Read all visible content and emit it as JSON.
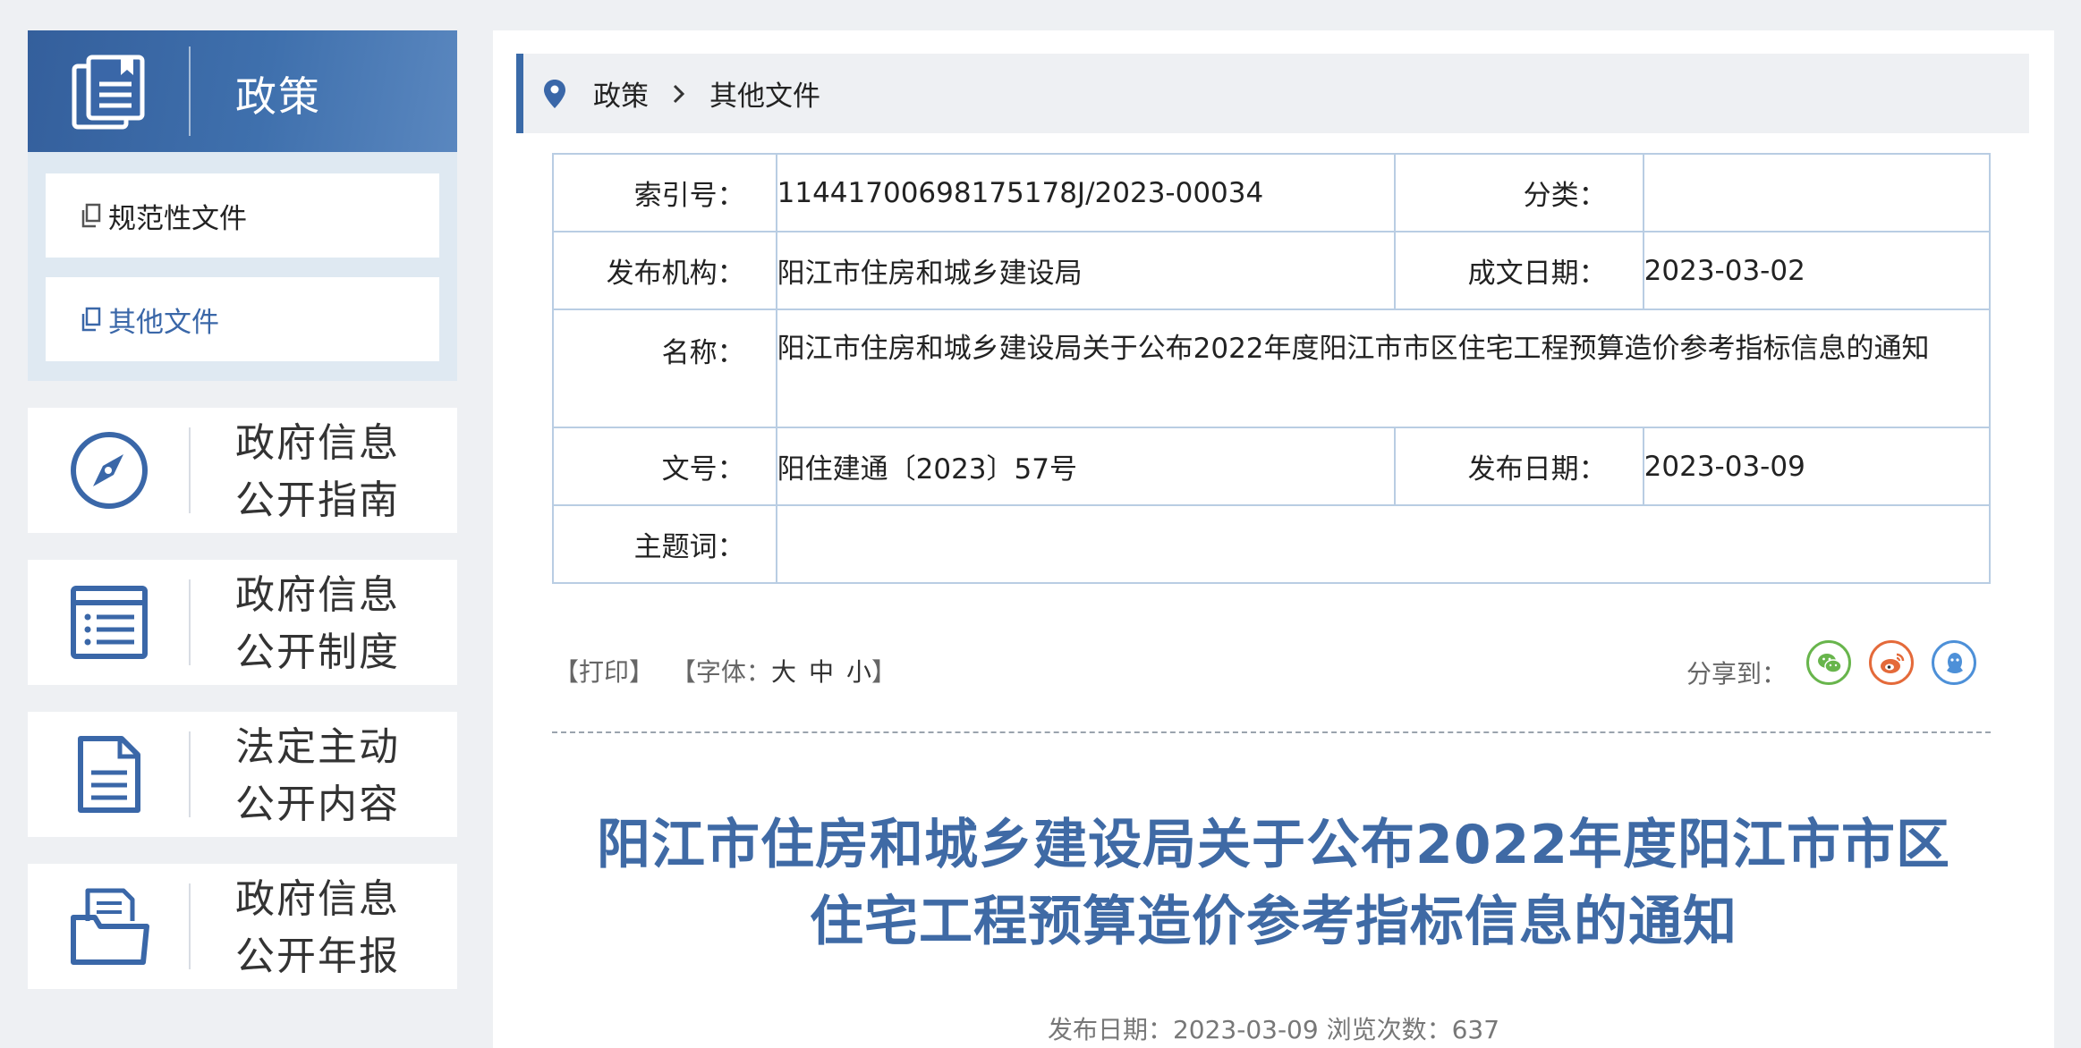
{
  "sidebar": {
    "header": {
      "title": "政策"
    },
    "sub_items": [
      {
        "label": "规范性文件"
      },
      {
        "label": "其他文件"
      }
    ],
    "nav_cards": [
      {
        "line1": "政府信息",
        "line2": "公开指南",
        "icon": "compass-icon"
      },
      {
        "line1": "政府信息",
        "line2": "公开制度",
        "icon": "list-document-icon"
      },
      {
        "line1": "法定主动",
        "line2": "公开内容",
        "icon": "document-icon"
      },
      {
        "line1": "政府信息",
        "line2": "公开年报",
        "icon": "open-folder-icon"
      }
    ]
  },
  "breadcrumb": {
    "items": [
      "政策",
      "其他文件"
    ]
  },
  "meta": {
    "index_label": "索引号：",
    "index_value": "11441700698175178J/2023-00034",
    "category_label": "分类：",
    "category_value": "",
    "issuer_label": "发布机构：",
    "issuer_value": "阳江市住房和城乡建设局",
    "written_date_label": "成文日期：",
    "written_date_value": "2023-03-02",
    "name_label": "名称：",
    "name_value": "阳江市住房和城乡建设局关于公布2022年度阳江市市区住宅工程预算造价参考指标信息的通知",
    "doc_no_label": "文号：",
    "doc_no_value": "阳住建通〔2023〕57号",
    "publish_date_label": "发布日期：",
    "publish_date_value": "2023-03-09",
    "keywords_label": "主题词：",
    "keywords_value": ""
  },
  "tools": {
    "print": "【打印】",
    "font_prefix": "【字体：",
    "font_large": "大",
    "font_medium": "中",
    "font_small": "小",
    "font_suffix": "】",
    "share_label": "分享到："
  },
  "article": {
    "title_line1": "阳江市住房和城乡建设局关于公布2022年度阳江市市区",
    "title_line2": "住宅工程预算造价参考指标信息的通知",
    "meta_text": "发布日期：2023-03-09  浏览次数：637"
  },
  "colors": {
    "primary": "#3a6aa8",
    "title_blue": "#3f6aa5",
    "table_border": "#b9cde3",
    "wechat": "#68b54c",
    "weibo": "#e46a3a",
    "qq": "#4d90d8"
  }
}
